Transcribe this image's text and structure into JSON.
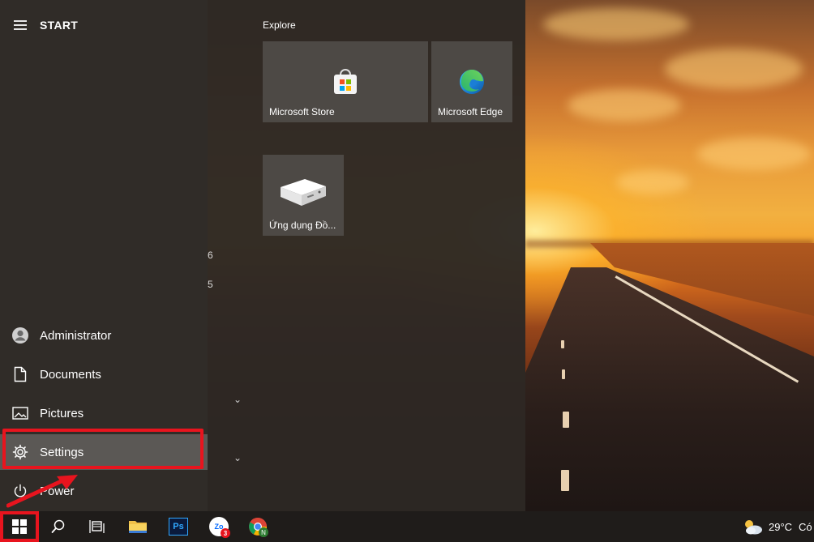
{
  "start_menu": {
    "title": "START",
    "nav_items": [
      {
        "label": "Administrator",
        "icon": "user-avatar-icon"
      },
      {
        "label": "Documents",
        "icon": "document-icon"
      },
      {
        "label": "Pictures",
        "icon": "picture-icon"
      },
      {
        "label": "Settings",
        "icon": "gear-icon",
        "selected": true
      },
      {
        "label": "Power",
        "icon": "power-icon"
      }
    ],
    "partial_glyphs": [
      "6",
      "5"
    ],
    "tile_group": {
      "title": "Explore",
      "tiles": [
        {
          "label": "Microsoft Store",
          "icon": "store-bag-icon"
        },
        {
          "label": "Microsoft Edge",
          "icon": "edge-icon"
        },
        {
          "label": "Ứng dụng Đồ...",
          "icon": "device-box-icon"
        }
      ]
    }
  },
  "taskbar": {
    "items": [
      {
        "name": "start",
        "icon": "windows-logo-icon"
      },
      {
        "name": "search",
        "icon": "search-icon"
      },
      {
        "name": "task-view",
        "icon": "task-view-icon"
      },
      {
        "name": "file-explorer",
        "icon": "folder-icon"
      },
      {
        "name": "photoshop",
        "icon": "photoshop-icon",
        "text": "Ps"
      },
      {
        "name": "zalo",
        "icon": "zalo-icon",
        "text": "Zo",
        "badge": "3"
      },
      {
        "name": "chrome",
        "icon": "chrome-icon",
        "badge": "N"
      }
    ],
    "weather": {
      "temp": "29°C",
      "text": "Có"
    }
  },
  "colors": {
    "highlight": "#e8141e",
    "menu_bg": "#2c2824",
    "tile_bg": "#4d4945"
  }
}
